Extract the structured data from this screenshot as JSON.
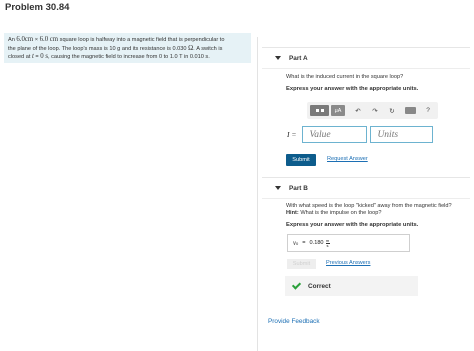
{
  "page": {
    "title": "Problem 30.84"
  },
  "problem": {
    "lines": [
      {
        "pre": "An ",
        "m1": "6.0cm",
        "mid": " × ",
        "m2": "6.0 cm",
        "post": " square loop is halfway into a magnetic field that is perpendicular to"
      },
      {
        "pre": "the plane of the loop. The loop's mass is 10 g and its resistance is 0.030 ",
        "m1": "Ω",
        "post": ". A switch is"
      },
      {
        "pre": "closed at ",
        "m1": "t",
        "mid": " = ",
        "m2": "0 s",
        "post": ", causing the magnetic field to increase from 0 to 1.0 T in 0.010 s."
      }
    ]
  },
  "part_a": {
    "header": "Part A",
    "question": "What is the induced current in the square loop?",
    "instruction": "Express your answer with the appropriate units.",
    "toolbar": {
      "mu_label": "μA",
      "undo_glyph": "↶",
      "redo_glyph": "↷",
      "reset_glyph": "↻",
      "help_glyph": "?"
    },
    "var_label": "I =",
    "value_placeholder": "Value",
    "units_placeholder": "Units",
    "submit_label": "Submit",
    "request_answer_label": "Request Answer"
  },
  "part_b": {
    "header": "Part B",
    "question_line1": "With what speed is the loop \"kicked\" away from the magnetic field?",
    "hint_label": "Hint:",
    "hint_text": "What is the impulse on the loop?",
    "instruction": "Express your answer with the appropriate units.",
    "answer_var": "v",
    "answer_sub": "0",
    "answer_eq": "=",
    "answer_value": "0.180",
    "unit_num": "m",
    "unit_den": "s",
    "submit_label": "Submit",
    "previous_answers_label": "Previous Answers",
    "status": "Correct"
  },
  "footer": {
    "feedback_label": "Provide Feedback"
  },
  "icons": [
    "collapse-triangle-icon",
    "template-grid-icon",
    "undo-icon",
    "redo-icon",
    "reset-icon",
    "keyboard-icon",
    "help-icon",
    "checkmark-icon"
  ],
  "colors": {
    "accent": "#0d5c8c",
    "link": "#1c6fb4",
    "problem_bg": "#e6f2f6",
    "correct": "#2aa03a",
    "input_border": "#6db3d0"
  }
}
